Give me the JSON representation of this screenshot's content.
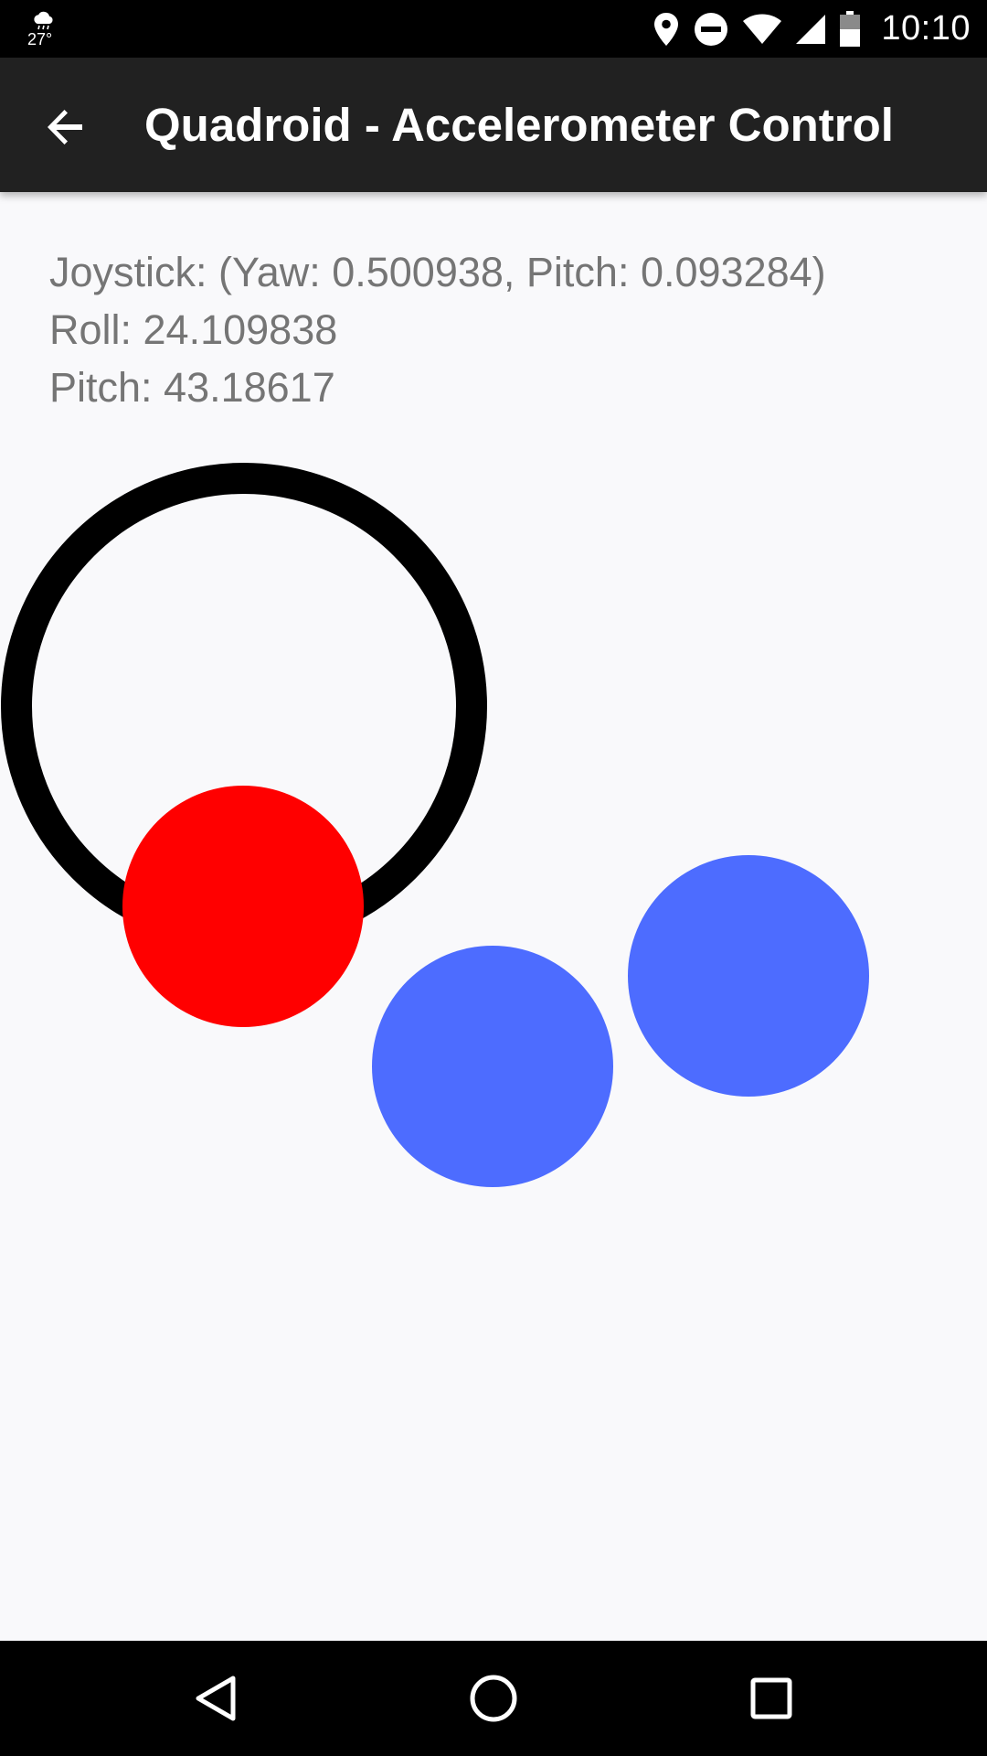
{
  "status_bar": {
    "weather_temp": "27°",
    "weather_icon": "cloud-icon",
    "icons": [
      "location-pin-icon",
      "do-not-disturb-icon",
      "wifi-icon",
      "cell-signal-icon",
      "battery-icon"
    ],
    "time": "10:10"
  },
  "app_bar": {
    "back_icon": "arrow-back-icon",
    "title": "Quadroid - Accelerometer Control",
    "background": "#212121"
  },
  "info": {
    "joystick": "Joystick: (Yaw: 0.500938, Pitch: 0.093284)",
    "roll": "Roll: 24.109838",
    "pitch": "Pitch: 43.18617"
  },
  "controls": {
    "ring_color": "#000000",
    "thumb_color": "#ff0000",
    "blue_indicator_color": "#4d6cff"
  },
  "nav_bar": {
    "buttons": [
      "back-triangle-icon",
      "home-circle-icon",
      "recents-square-icon"
    ]
  }
}
